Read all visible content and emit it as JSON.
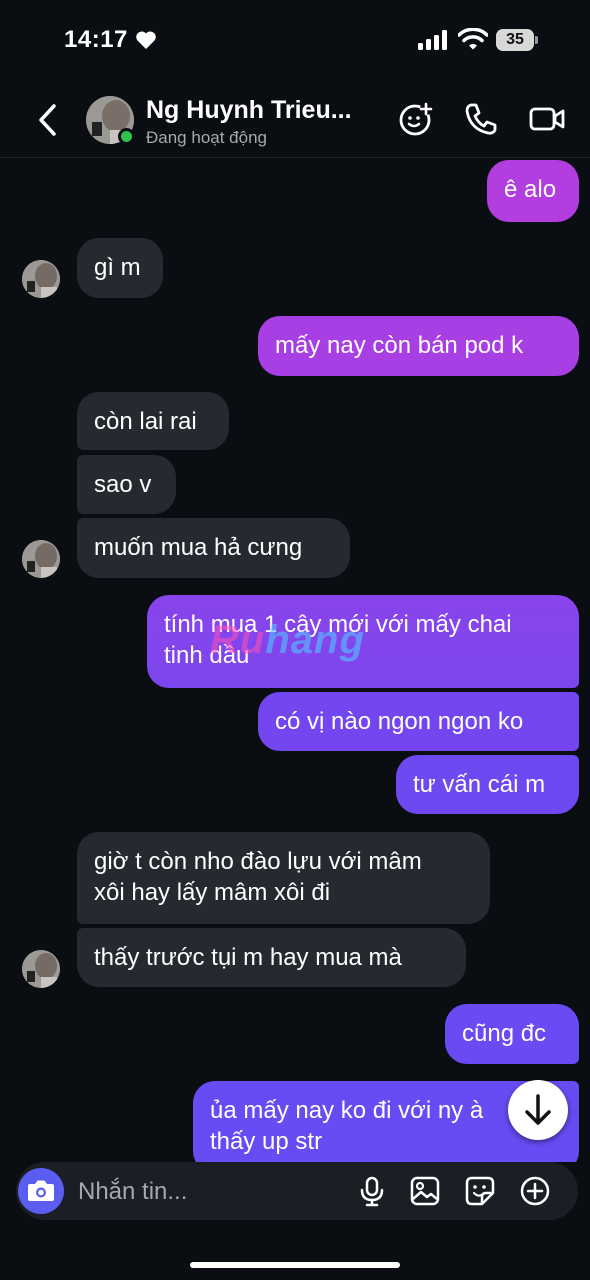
{
  "status_bar": {
    "time": "14:17",
    "battery": "35"
  },
  "header": {
    "contact_name": "Ng Huynh Trieu...",
    "contact_status": "Đang hoạt động",
    "icons": [
      "back-chevron-icon",
      "avatar-effects-icon",
      "phone-icon",
      "video-icon"
    ]
  },
  "messages": [
    {
      "dir": "out",
      "text": "ê alo"
    },
    {
      "dir": "in",
      "text": "gì m"
    },
    {
      "dir": "out",
      "text": "mấy nay còn bán pod k"
    },
    {
      "dir": "in",
      "text": "còn lai rai"
    },
    {
      "dir": "in",
      "text": "sao v"
    },
    {
      "dir": "in",
      "text": "muốn mua hả cưng"
    },
    {
      "dir": "out",
      "lines": [
        "tính mua 1 cây mới với mấy chai",
        "tinh dầu"
      ]
    },
    {
      "dir": "out",
      "text": "có vị nào ngon ngon ko"
    },
    {
      "dir": "out",
      "text": "tư vấn cái m"
    },
    {
      "dir": "in",
      "lines": [
        "giờ t còn nho đào lựu với mâm",
        "xôi hay lấy mâm xôi đi"
      ]
    },
    {
      "dir": "in",
      "text": "thấy trước tụi m hay mua mà"
    },
    {
      "dir": "out",
      "text": "cũng đc"
    },
    {
      "dir": "out",
      "lines": [
        "ủa mấy nay ko đi với ny à",
        "thấy up str"
      ]
    }
  ],
  "watermark": {
    "part1": "Ru",
    "part2": "hang"
  },
  "composer": {
    "placeholder": "Nhắn tin...",
    "icons": [
      "camera-icon",
      "microphone-icon",
      "image-icon",
      "sticker-icon",
      "plus-icon"
    ]
  },
  "colors": {
    "out_top": "#b33ee0",
    "out_bottom": "#6b48f0",
    "in": "#262a30",
    "accent": "#5b5cf0"
  }
}
